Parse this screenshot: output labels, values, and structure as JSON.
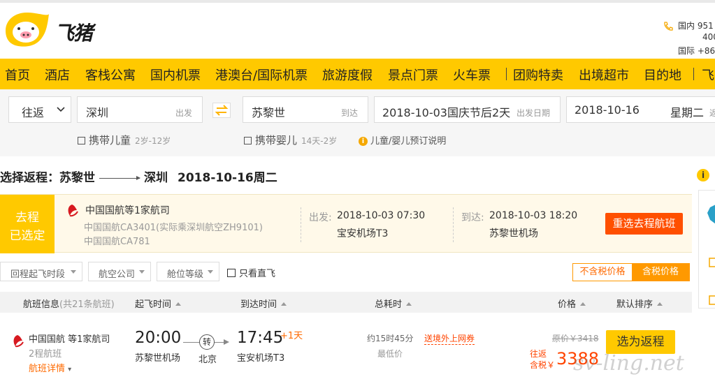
{
  "header": {
    "brand": "飞猪",
    "phone_domestic_label": "国内",
    "phone_domestic_1": "951",
    "phone_domestic_2": "400",
    "phone_intl_label": "国际",
    "phone_intl": "+86"
  },
  "nav": {
    "items": [
      "首页",
      "酒店",
      "客栈公寓",
      "国内机票",
      "港澳台/国际机票",
      "旅游度假",
      "景点门票",
      "火车票",
      "团购特卖",
      "出境超市",
      "目的地",
      "飞"
    ]
  },
  "search": {
    "trip_type": "往返",
    "from_city": "深圳",
    "from_hint": "出发",
    "to_city": "苏黎世",
    "to_hint": "到达",
    "depart_date": "2018-10-03国庆节后2天",
    "depart_hint": "出发日期",
    "return_date": "2018-10-16",
    "return_weekday": "星期二",
    "return_hint": "返",
    "child_label": "携带儿童",
    "child_age": "2岁-12岁",
    "infant_label": "携带婴儿",
    "infant_age": "14天-2岁",
    "booking_note": "儿童/婴儿预订说明"
  },
  "route": {
    "prefix": "选择返程：",
    "from": "苏黎世",
    "to": "深圳",
    "date": "2018-10-16周二"
  },
  "selected": {
    "badge_line1": "去程",
    "badge_line2": "已选定",
    "airline": "中国国航等1家航司",
    "flight_1": "中国国航CA3401(实际乘深圳航空ZH9101)",
    "flight_2": "中国国航CA781",
    "depart_label": "出发:",
    "depart_time": "2018-10-03 07:30",
    "depart_airport": "宝安机场T3",
    "arrive_label": "到达:",
    "arrive_time": "2018-10-03 18:20",
    "arrive_airport": "苏黎世机场",
    "reselect_button": "重选去程航班"
  },
  "filters": {
    "time": "回程起飞时段",
    "airline": "航空公司",
    "cabin": "舱位等级",
    "direct_only": "只看直飞",
    "price_excl_tax": "不含税价格",
    "price_incl_tax": "含税价格"
  },
  "table_header": {
    "flight_info": "航班信息",
    "flight_count": "(共21条航班)",
    "depart_time": "起飞时间",
    "arrive_time": "到达时间",
    "duration": "总耗时",
    "price": "价格",
    "sort": "默认排序"
  },
  "flight": {
    "airline": "中国国航 等1家航司",
    "legs": "2程航班",
    "details": "航班详情",
    "depart_time": "20:00",
    "depart_airport": "苏黎世机场",
    "transfer_mark": "转",
    "transfer_city": "北京",
    "arrive_time": "17:45",
    "arrive_plus_day": "+1天",
    "arrive_airport": "宝安机场T3",
    "duration": "约15时45分",
    "duration_note": "最低价",
    "promo": "送境外上网券",
    "original_price": "原价￥3418",
    "price_label_1": "往返",
    "price_label_2": "含税￥",
    "price": "3388",
    "select_button": "选为返程"
  },
  "watermark": "sv-ling.net",
  "colors": {
    "brand_yellow": "#ffc900",
    "accent_orange": "#ff5000",
    "price_red": "#ff4400"
  }
}
